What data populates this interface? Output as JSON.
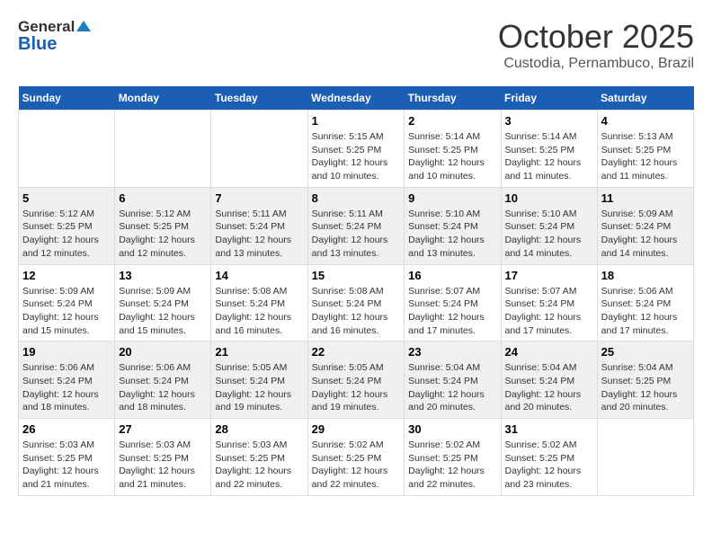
{
  "header": {
    "logo_general": "General",
    "logo_blue": "Blue",
    "month": "October 2025",
    "location": "Custodia, Pernambuco, Brazil"
  },
  "weekdays": [
    "Sunday",
    "Monday",
    "Tuesday",
    "Wednesday",
    "Thursday",
    "Friday",
    "Saturday"
  ],
  "weeks": [
    [
      {
        "day": "",
        "info": ""
      },
      {
        "day": "",
        "info": ""
      },
      {
        "day": "",
        "info": ""
      },
      {
        "day": "1",
        "info": "Sunrise: 5:15 AM\nSunset: 5:25 PM\nDaylight: 12 hours\nand 10 minutes."
      },
      {
        "day": "2",
        "info": "Sunrise: 5:14 AM\nSunset: 5:25 PM\nDaylight: 12 hours\nand 10 minutes."
      },
      {
        "day": "3",
        "info": "Sunrise: 5:14 AM\nSunset: 5:25 PM\nDaylight: 12 hours\nand 11 minutes."
      },
      {
        "day": "4",
        "info": "Sunrise: 5:13 AM\nSunset: 5:25 PM\nDaylight: 12 hours\nand 11 minutes."
      }
    ],
    [
      {
        "day": "5",
        "info": "Sunrise: 5:12 AM\nSunset: 5:25 PM\nDaylight: 12 hours\nand 12 minutes."
      },
      {
        "day": "6",
        "info": "Sunrise: 5:12 AM\nSunset: 5:25 PM\nDaylight: 12 hours\nand 12 minutes."
      },
      {
        "day": "7",
        "info": "Sunrise: 5:11 AM\nSunset: 5:24 PM\nDaylight: 12 hours\nand 13 minutes."
      },
      {
        "day": "8",
        "info": "Sunrise: 5:11 AM\nSunset: 5:24 PM\nDaylight: 12 hours\nand 13 minutes."
      },
      {
        "day": "9",
        "info": "Sunrise: 5:10 AM\nSunset: 5:24 PM\nDaylight: 12 hours\nand 13 minutes."
      },
      {
        "day": "10",
        "info": "Sunrise: 5:10 AM\nSunset: 5:24 PM\nDaylight: 12 hours\nand 14 minutes."
      },
      {
        "day": "11",
        "info": "Sunrise: 5:09 AM\nSunset: 5:24 PM\nDaylight: 12 hours\nand 14 minutes."
      }
    ],
    [
      {
        "day": "12",
        "info": "Sunrise: 5:09 AM\nSunset: 5:24 PM\nDaylight: 12 hours\nand 15 minutes."
      },
      {
        "day": "13",
        "info": "Sunrise: 5:09 AM\nSunset: 5:24 PM\nDaylight: 12 hours\nand 15 minutes."
      },
      {
        "day": "14",
        "info": "Sunrise: 5:08 AM\nSunset: 5:24 PM\nDaylight: 12 hours\nand 16 minutes."
      },
      {
        "day": "15",
        "info": "Sunrise: 5:08 AM\nSunset: 5:24 PM\nDaylight: 12 hours\nand 16 minutes."
      },
      {
        "day": "16",
        "info": "Sunrise: 5:07 AM\nSunset: 5:24 PM\nDaylight: 12 hours\nand 17 minutes."
      },
      {
        "day": "17",
        "info": "Sunrise: 5:07 AM\nSunset: 5:24 PM\nDaylight: 12 hours\nand 17 minutes."
      },
      {
        "day": "18",
        "info": "Sunrise: 5:06 AM\nSunset: 5:24 PM\nDaylight: 12 hours\nand 17 minutes."
      }
    ],
    [
      {
        "day": "19",
        "info": "Sunrise: 5:06 AM\nSunset: 5:24 PM\nDaylight: 12 hours\nand 18 minutes."
      },
      {
        "day": "20",
        "info": "Sunrise: 5:06 AM\nSunset: 5:24 PM\nDaylight: 12 hours\nand 18 minutes."
      },
      {
        "day": "21",
        "info": "Sunrise: 5:05 AM\nSunset: 5:24 PM\nDaylight: 12 hours\nand 19 minutes."
      },
      {
        "day": "22",
        "info": "Sunrise: 5:05 AM\nSunset: 5:24 PM\nDaylight: 12 hours\nand 19 minutes."
      },
      {
        "day": "23",
        "info": "Sunrise: 5:04 AM\nSunset: 5:24 PM\nDaylight: 12 hours\nand 20 minutes."
      },
      {
        "day": "24",
        "info": "Sunrise: 5:04 AM\nSunset: 5:24 PM\nDaylight: 12 hours\nand 20 minutes."
      },
      {
        "day": "25",
        "info": "Sunrise: 5:04 AM\nSunset: 5:25 PM\nDaylight: 12 hours\nand 20 minutes."
      }
    ],
    [
      {
        "day": "26",
        "info": "Sunrise: 5:03 AM\nSunset: 5:25 PM\nDaylight: 12 hours\nand 21 minutes."
      },
      {
        "day": "27",
        "info": "Sunrise: 5:03 AM\nSunset: 5:25 PM\nDaylight: 12 hours\nand 21 minutes."
      },
      {
        "day": "28",
        "info": "Sunrise: 5:03 AM\nSunset: 5:25 PM\nDaylight: 12 hours\nand 22 minutes."
      },
      {
        "day": "29",
        "info": "Sunrise: 5:02 AM\nSunset: 5:25 PM\nDaylight: 12 hours\nand 22 minutes."
      },
      {
        "day": "30",
        "info": "Sunrise: 5:02 AM\nSunset: 5:25 PM\nDaylight: 12 hours\nand 22 minutes."
      },
      {
        "day": "31",
        "info": "Sunrise: 5:02 AM\nSunset: 5:25 PM\nDaylight: 12 hours\nand 23 minutes."
      },
      {
        "day": "",
        "info": ""
      }
    ]
  ]
}
